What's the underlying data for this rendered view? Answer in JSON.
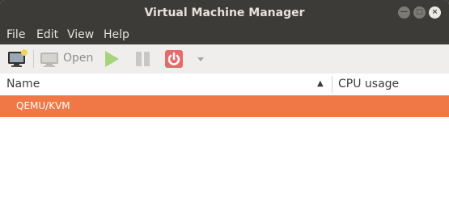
{
  "window": {
    "title": "Virtual Machine Manager",
    "controls": [
      "minimize-icon",
      "maximize-icon",
      "close-icon"
    ]
  },
  "menu": {
    "items": [
      "File",
      "Edit",
      "View",
      "Help"
    ]
  },
  "toolbar": {
    "new_vm_icon": "monitor-new-icon",
    "open_label": "Open",
    "play_icon": "play-icon",
    "pause_icon": "pause-icon",
    "shutdown_icon": "power-icon",
    "dropdown_icon": "chevron-down-icon"
  },
  "list": {
    "columns": [
      "Name",
      "CPU usage"
    ],
    "sort_indicator": "▲",
    "rows": [
      "QEMU/KVM"
    ],
    "selected_row_color": "#f07746"
  },
  "colors": {
    "titlebar": "#3c3b37",
    "toolbar": "#efeeec",
    "accent": "#f07746"
  }
}
